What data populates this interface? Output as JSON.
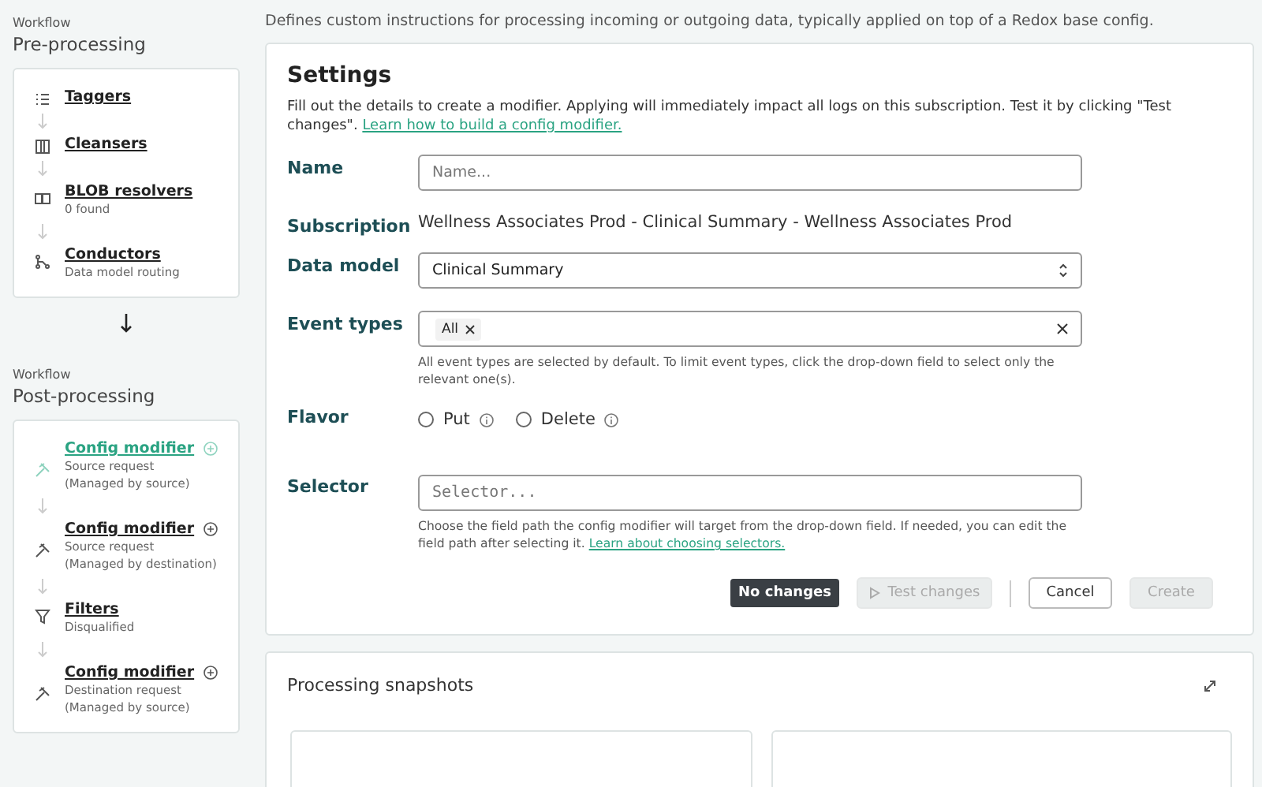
{
  "sidebar": {
    "sections": [
      {
        "eyebrow": "Workflow",
        "title": "Pre-processing",
        "items": [
          {
            "kind": "list",
            "label": "Taggers",
            "selected": false
          },
          {
            "kind": "columns",
            "label": "Cleansers",
            "selected": false
          },
          {
            "kind": "book",
            "label": "BLOB resolvers",
            "sub": [
              "0 found"
            ],
            "selected": false
          },
          {
            "kind": "branch",
            "label": "Conductors",
            "sub": [
              "Data model routing"
            ],
            "selected": false
          }
        ]
      },
      {
        "eyebrow": "Workflow",
        "title": "Post-processing",
        "items": [
          {
            "kind": "hammer",
            "label": "Config modifier",
            "add": true,
            "sub": [
              "Source request",
              "(Managed by source)"
            ],
            "selected": true
          },
          {
            "kind": "hammer",
            "label": "Config modifier",
            "add": true,
            "sub": [
              "Source request",
              "(Managed by destination)"
            ],
            "selected": false
          },
          {
            "kind": "filter",
            "label": "Filters",
            "sub": [
              "Disqualified"
            ],
            "selected": false
          },
          {
            "kind": "hammer",
            "label": "Config modifier",
            "add": true,
            "sub": [
              "Destination request",
              "(Managed by source)"
            ],
            "selected": false
          }
        ]
      }
    ]
  },
  "description": "Defines custom instructions for processing incoming or outgoing data, typically applied on top of a Redox base config.",
  "settings": {
    "title": "Settings",
    "intro": "Fill out the details to create a modifier. Applying will immediately impact all logs on this subscription. Test it by clicking \"Test changes\".",
    "intro_link": "Learn how to build a config modifier.",
    "name": {
      "label": "Name",
      "placeholder": "Name..."
    },
    "subscription": {
      "label": "Subscription",
      "value": "Wellness Associates Prod - Clinical Summary - Wellness Associates Prod"
    },
    "data_model": {
      "label": "Data model",
      "value": "Clinical Summary"
    },
    "event_types": {
      "label": "Event types",
      "tags": [
        "All"
      ],
      "hint": "All event types are selected by default. To limit event types, click the drop-down field to select only the relevant one(s)."
    },
    "flavor": {
      "label": "Flavor",
      "options": [
        {
          "label": "Put",
          "selected": false
        },
        {
          "label": "Delete",
          "selected": false
        }
      ]
    },
    "selector": {
      "label": "Selector",
      "placeholder": "Selector...",
      "hint": "Choose the field path the config modifier will target from the drop-down field. If needed, you can edit the field path after selecting it.",
      "hint_link": "Learn about choosing selectors."
    },
    "status": "No changes",
    "buttons": [
      {
        "label": "Test changes",
        "kind": "test",
        "disabled": true
      },
      {
        "label": "Cancel",
        "kind": "cancel",
        "disabled": false
      },
      {
        "label": "Create",
        "kind": "create",
        "disabled": true
      }
    ]
  },
  "snapshots": {
    "title": "Processing snapshots"
  }
}
